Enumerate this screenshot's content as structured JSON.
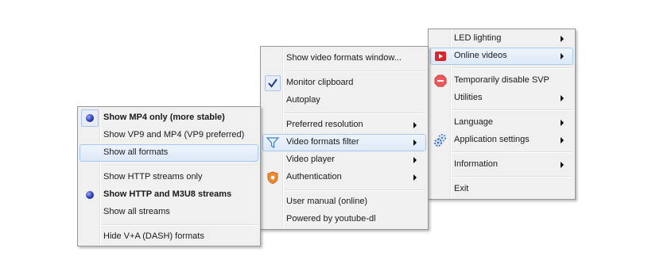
{
  "main_menu": {
    "items": [
      {
        "label": "LED lighting",
        "submenu": true
      },
      {
        "label": "Online videos",
        "submenu": true,
        "icon": "play-video-icon"
      },
      {
        "label": "Temporarily disable SVP",
        "icon": "stop-sign-icon"
      },
      {
        "label": "Utilities",
        "submenu": true
      },
      {
        "label": "Language",
        "submenu": true
      },
      {
        "label": "Application settings",
        "submenu": true,
        "icon": "gears-icon"
      },
      {
        "label": "Information",
        "submenu": true
      },
      {
        "label": "Exit"
      }
    ]
  },
  "online_videos_menu": {
    "items": [
      {
        "label": "Show video formats window..."
      },
      {
        "label": "Monitor clipboard",
        "checked": true
      },
      {
        "label": "Autoplay"
      },
      {
        "label": "Preferred resolution",
        "submenu": true
      },
      {
        "label": "Video formats filter",
        "submenu": true,
        "icon": "filter-icon"
      },
      {
        "label": "Video player",
        "submenu": true
      },
      {
        "label": "Authentication",
        "submenu": true,
        "icon": "shield-icon"
      },
      {
        "label": "User manual (online)"
      },
      {
        "label": "Powered by youtube-dl"
      }
    ]
  },
  "formats_filter_menu": {
    "items": [
      {
        "label": "Show MP4 only (more stable)",
        "selected": true,
        "bold": true
      },
      {
        "label": "Show VP9 and MP4 (VP9 preferred)"
      },
      {
        "label": "Show all formats"
      },
      {
        "label": "Show HTTP streams only"
      },
      {
        "label": "Show HTTP and M3U8 streams",
        "selected": true,
        "bold": true
      },
      {
        "label": "Show all streams"
      },
      {
        "label": "Hide V+A (DASH) formats"
      }
    ]
  },
  "colors": {
    "menu_background": "#f0f0f0",
    "highlight_border": "#a8c9ee",
    "play_icon_red": "#d9262b",
    "radio_bullet_blue": "#2b3bb0"
  }
}
